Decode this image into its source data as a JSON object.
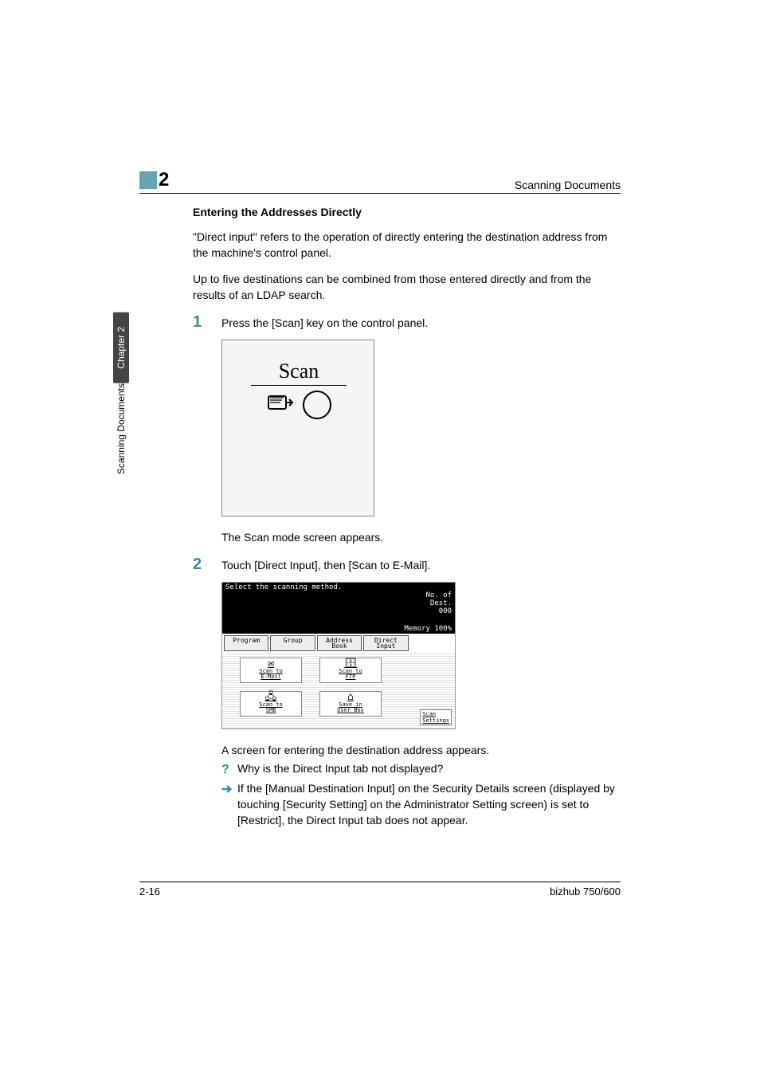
{
  "header": {
    "chapter_num": "2",
    "section_title": "Scanning Documents"
  },
  "sidetab": {
    "chapter": "Chapter 2",
    "section": "Scanning Documents"
  },
  "content": {
    "heading": "Entering the Addresses Directly",
    "para1": "\"Direct input\" refers to the operation of directly entering the destination address from the machine's control panel.",
    "para2": "Up to five destinations can be combined from those entered directly and from the results of an LDAP search.",
    "step1_num": "1",
    "step1_text": "Press the [Scan] key on the control panel.",
    "scan_label": "Scan",
    "after_scan": "The Scan mode screen appears.",
    "step2_num": "2",
    "step2_text": "Touch [Direct Input], then [Scan to E-Mail].",
    "screen": {
      "title": "Select the scanning method.",
      "dest_label": "No. of\nDest.",
      "dest_count": "000",
      "mem_label": "Memory",
      "mem_value": "100%",
      "tabs": [
        "Program",
        "Group",
        "Address\nBook",
        "Direct\nInput"
      ],
      "buttons": {
        "email": "Scan to\nE-Mail",
        "ftp": "Scan to\nFTP",
        "smb": "Scan to\nSMB",
        "userbox": "Save in\nUser Box",
        "settings": "Scan\nSettings"
      }
    },
    "after_screen": "A screen for entering the destination address appears.",
    "q_mark": "?",
    "q_text": "Why is the Direct Input tab not displayed?",
    "a_mark": "➔",
    "a_text": "If the [Manual Destination Input] on the Security Details screen (displayed by touching [Security Setting] on the Administrator Setting screen) is set to [Restrict], the Direct Input tab does not appear."
  },
  "footer": {
    "page": "2-16",
    "model": "bizhub 750/600"
  }
}
